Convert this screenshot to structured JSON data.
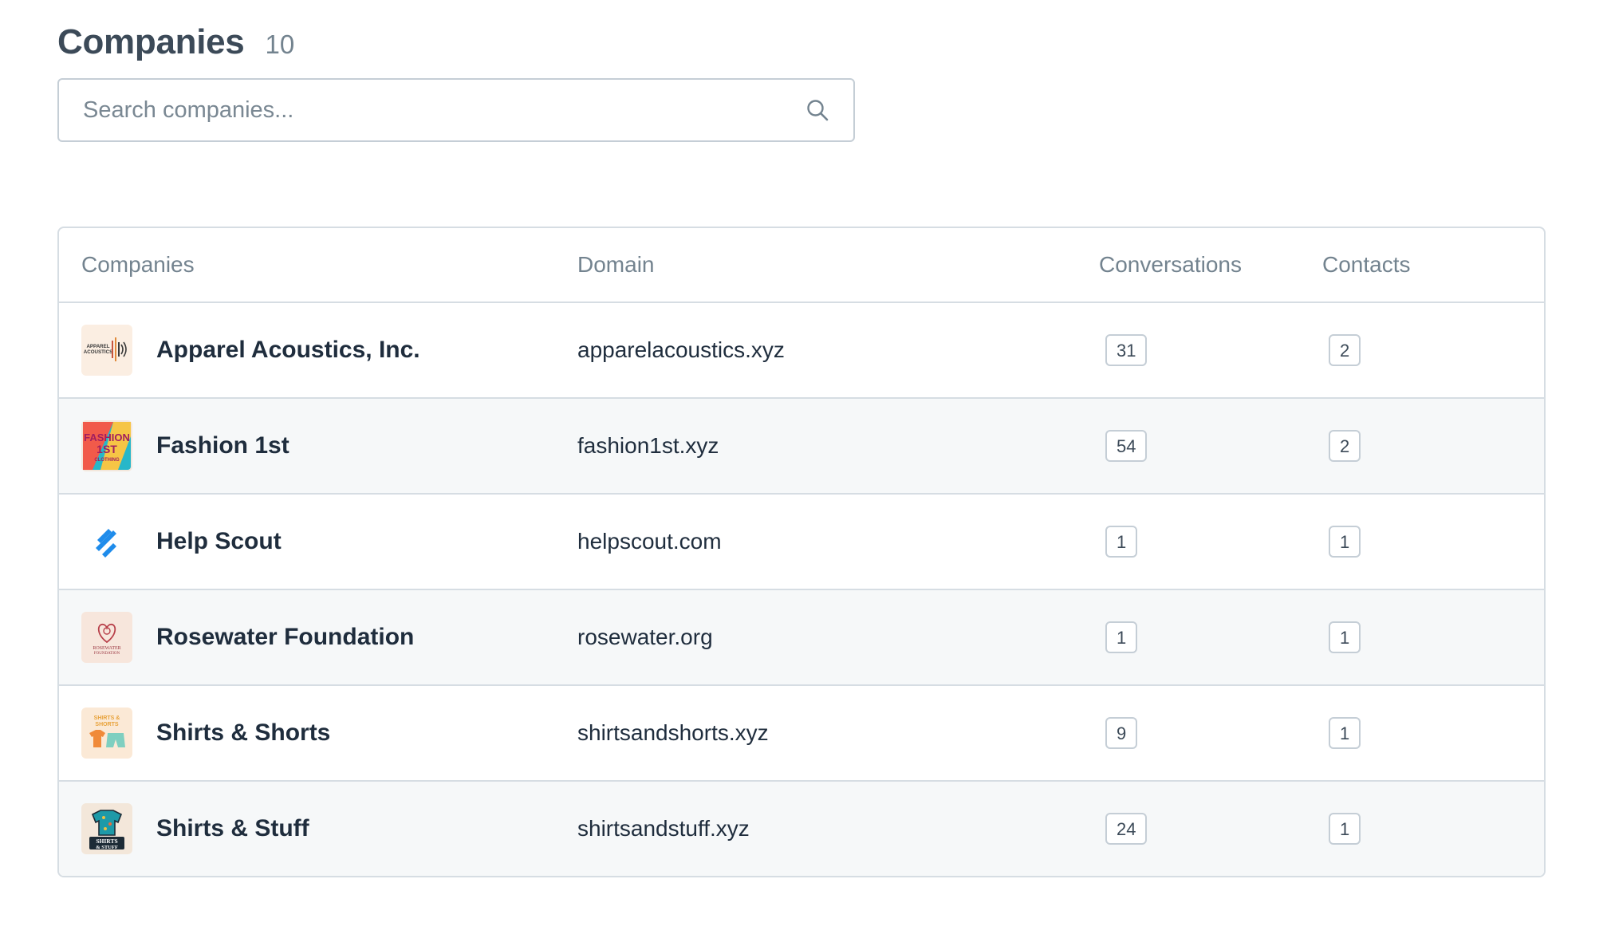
{
  "header": {
    "title": "Companies",
    "count": "10"
  },
  "search": {
    "placeholder": "Search companies...",
    "value": "",
    "icon": "search-icon"
  },
  "table": {
    "columns": {
      "company": "Companies",
      "domain": "Domain",
      "conversations": "Conversations",
      "contacts": "Contacts"
    },
    "rows": [
      {
        "name": "Apparel Acoustics, Inc.",
        "domain": "apparelacoustics.xyz",
        "conversations": "31",
        "contacts": "2",
        "logo": "apparel-acoustics-logo",
        "logo_text": "APPAREL ACOUSTICS"
      },
      {
        "name": "Fashion 1st",
        "domain": "fashion1st.xyz",
        "conversations": "54",
        "contacts": "2",
        "logo": "fashion-1st-logo",
        "logo_text": "FASHION 1ST CLOTHING"
      },
      {
        "name": "Help Scout",
        "domain": "helpscout.com",
        "conversations": "1",
        "contacts": "1",
        "logo": "help-scout-logo"
      },
      {
        "name": "Rosewater Foundation",
        "domain": "rosewater.org",
        "conversations": "1",
        "contacts": "1",
        "logo": "rosewater-foundation-logo",
        "logo_text": "ROSEWATER FOUNDATION"
      },
      {
        "name": "Shirts & Shorts",
        "domain": "shirtsandshorts.xyz",
        "conversations": "9",
        "contacts": "1",
        "logo": "shirts-and-shorts-logo",
        "logo_text": "SHIRTS & SHORTS"
      },
      {
        "name": "Shirts & Stuff",
        "domain": "shirtsandstuff.xyz",
        "conversations": "24",
        "contacts": "1",
        "logo": "shirts-and-stuff-logo",
        "logo_text": "SHIRTS & STUFF"
      }
    ]
  },
  "colors": {
    "title": "#3c4a58",
    "muted": "#73838f",
    "border": "#d6dde3",
    "row_alt": "#f6f8f9",
    "helpscout_blue": "#1f8ceb"
  }
}
